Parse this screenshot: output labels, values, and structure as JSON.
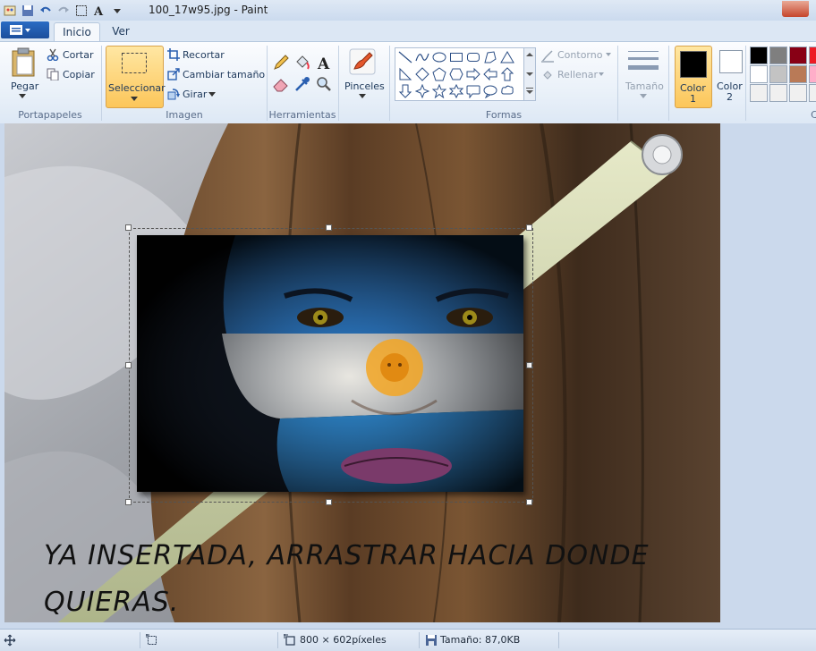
{
  "window": {
    "title": "100_17w95.jpg - Paint"
  },
  "tabs": [
    {
      "label": "Inicio"
    },
    {
      "label": "Ver"
    }
  ],
  "ribbon": {
    "portapapeles": {
      "group_label": "Portapapeles",
      "paste_label": "Pegar",
      "cut_label": "Cortar",
      "copy_label": "Copiar"
    },
    "imagen": {
      "group_label": "Imagen",
      "select_label": "Seleccionar",
      "crop_label": "Recortar",
      "resize_label": "Cambiar tamaño",
      "rotate_label": "Girar"
    },
    "herramientas": {
      "group_label": "Herramientas"
    },
    "pinceles": {
      "label": "Pinceles"
    },
    "formas": {
      "group_label": "Formas",
      "outline_label": "Contorno",
      "fill_label": "Rellenar"
    },
    "tamano": {
      "label": "Tamaño"
    },
    "colors": {
      "color1_label": "Color",
      "color1_num": "1",
      "color2_label": "Color",
      "color2_num": "2",
      "color1_value": "#000000",
      "color2_value": "#ffffff",
      "palette": [
        "#000000",
        "#7f7f7f",
        "#880015",
        "#ed1c24",
        "#ffffff",
        "#c3c3c3",
        "#b97a57",
        "#ffaec9"
      ],
      "partial_group_label": "C"
    }
  },
  "canvas": {
    "caption_line1": "YA INSERTADA, ARRASTRAR HACIA DONDE",
    "caption_line2": "QUIERAS."
  },
  "statusbar": {
    "dimensions": "800 × 602píxeles",
    "size": "Tamaño: 87,0KB"
  }
}
